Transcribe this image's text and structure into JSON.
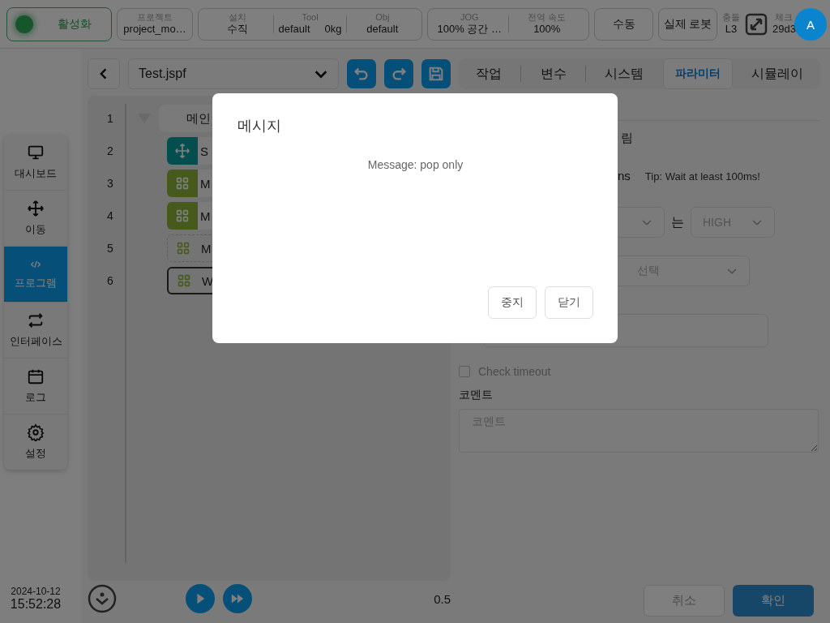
{
  "top_bar": {
    "activate": {
      "label": "활성화",
      "on": true
    },
    "project": {
      "label": "프로젝트",
      "value": "project_mo…"
    },
    "setup": [
      {
        "label": "설치",
        "value": "수직"
      },
      {
        "label": "Tool",
        "value": "default",
        "extra": "0kg"
      },
      {
        "label": "Obj",
        "value": "default"
      }
    ],
    "jog": [
      {
        "label": "JOG",
        "value": "100%  공간 …"
      },
      {
        "label": "전역 속도",
        "value": "100%"
      }
    ],
    "mode_buttons": [
      "수동",
      "실제 로봇"
    ],
    "collision": {
      "label": "충돌",
      "value": "L3"
    },
    "check": {
      "label": "체크",
      "value": "29d3"
    },
    "avatar": "A"
  },
  "sidebar": {
    "items": [
      {
        "label": "대시보드",
        "selected": false
      },
      {
        "label": "이동",
        "selected": false
      },
      {
        "label": "프로그램",
        "selected": true
      },
      {
        "label": "인터페이스",
        "selected": false
      },
      {
        "label": "로그",
        "selected": false
      },
      {
        "label": "설정",
        "selected": false
      }
    ],
    "date": "2024-10-12",
    "time": "15:52:28"
  },
  "editor": {
    "file": "Test.jspf",
    "rows": [
      {
        "number": "1",
        "kind": "main",
        "text": "메인"
      },
      {
        "number": "2",
        "kind": "move",
        "text": "S"
      },
      {
        "number": "3",
        "kind": "group",
        "text": "M"
      },
      {
        "number": "4",
        "kind": "group",
        "text": "M"
      },
      {
        "number": "5",
        "kind": "group_dashed",
        "text": "M"
      },
      {
        "number": "6",
        "kind": "group_outlined",
        "text": "W"
      }
    ],
    "speed": "0.5"
  },
  "tabs": [
    {
      "label": "작업",
      "selected": false
    },
    {
      "label": "변수",
      "selected": false
    },
    {
      "label": "시스템",
      "selected": false
    },
    {
      "label": "파라미터",
      "selected": true
    },
    {
      "label": "시뮬레이",
      "selected": false
    }
  ],
  "panel": {
    "heading": "림",
    "unit": "ns",
    "tip": "Tip: Wait at least 100ms!",
    "connector": "는",
    "level_select": "HIGH",
    "choose_select": "선택",
    "check_timeout": {
      "label": "Check timeout",
      "checked": false
    },
    "comment_label": "코멘트",
    "comment_placeholder": "코멘트",
    "buttons": [
      "취소",
      "확인"
    ]
  },
  "dialog": {
    "title": "메시지",
    "message": "Message: pop only",
    "buttons": [
      "중지",
      "닫기"
    ]
  }
}
